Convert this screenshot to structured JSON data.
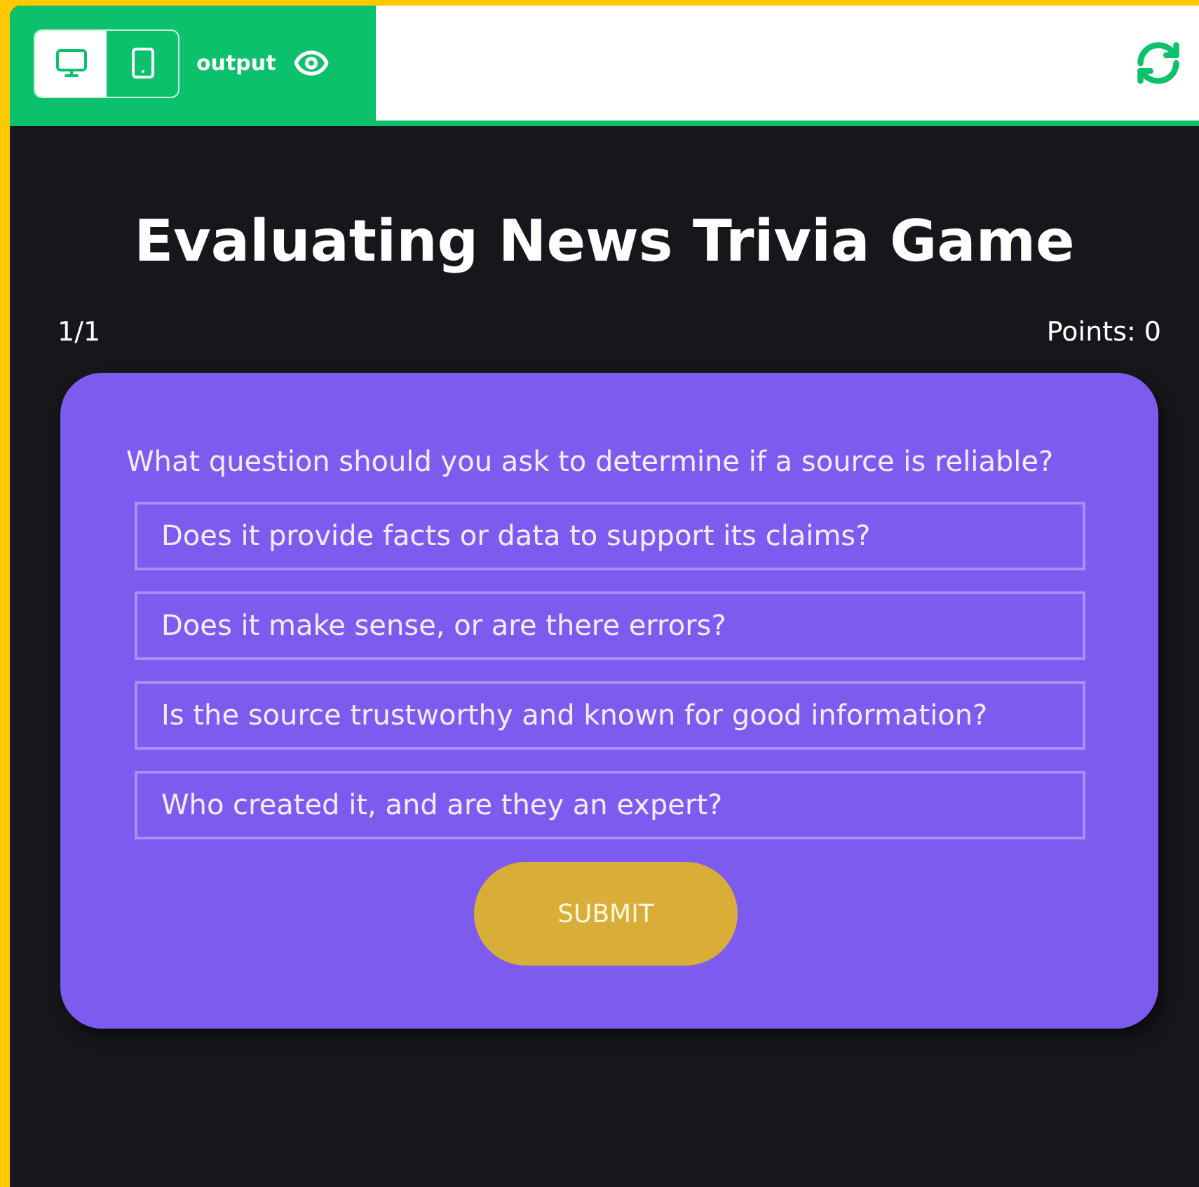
{
  "toolbar": {
    "view_toggle": [
      {
        "kind": "desktop",
        "selected": true
      },
      {
        "kind": "mobile",
        "selected": false
      }
    ],
    "label": "output"
  },
  "title": "Evaluating News Trivia Game",
  "progress": "1/1",
  "points": "Points: 0",
  "question": "What question should you ask to determine if a source is reliable?",
  "answers": [
    {
      "text": "Does it provide facts or data to support its claims?",
      "selected": false
    },
    {
      "text": "Does it make sense, or are there errors?",
      "selected": false
    },
    {
      "text": "Is the source trustworthy and known for good information?",
      "selected": false
    },
    {
      "text": "Who created it, and are they an expert?",
      "selected": false
    }
  ],
  "submit": "SUBMIT"
}
